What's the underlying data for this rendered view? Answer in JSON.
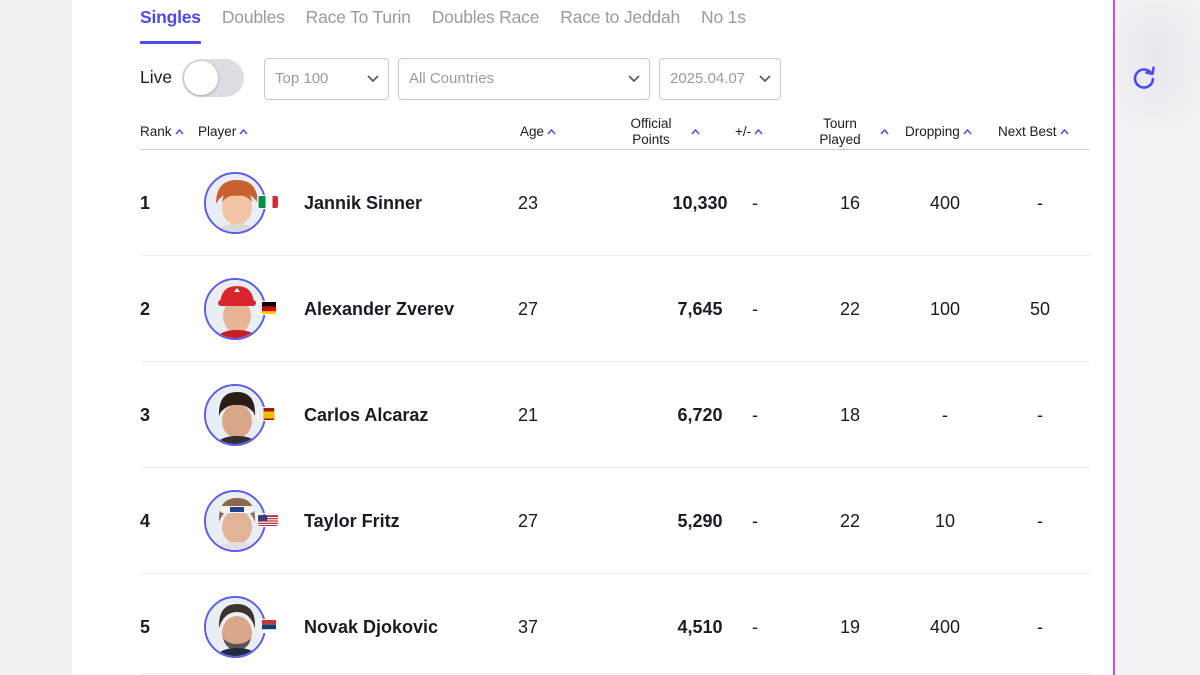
{
  "tabs": [
    {
      "label": "Singles",
      "active": true
    },
    {
      "label": "Doubles",
      "active": false
    },
    {
      "label": "Race To Turin",
      "active": false
    },
    {
      "label": "Doubles Race",
      "active": false
    },
    {
      "label": "Race to Jeddah",
      "active": false
    },
    {
      "label": "No 1s",
      "active": false
    }
  ],
  "filters": {
    "live_label": "Live",
    "live_on": false,
    "range": "Top 100",
    "country": "All Countries",
    "date": "2025.04.07",
    "refresh_icon": "refresh-icon"
  },
  "columns": {
    "rank": "Rank",
    "player": "Player",
    "age": "Age",
    "points_l1": "Official",
    "points_l2": "Points",
    "change": "+/-",
    "played_l1": "Tourn",
    "played_l2": "Played",
    "dropping": "Dropping",
    "next_best": "Next Best"
  },
  "colors": {
    "accent": "#4b4bf0",
    "text": "#1b1b25",
    "muted": "#9a9aa3"
  },
  "players": [
    {
      "rank": "1",
      "name": "Jannik Sinner",
      "age": "23",
      "points": "10,330",
      "change": "-",
      "played": "16",
      "dropping": "400",
      "next_best": "-",
      "flag": "flag-italy"
    },
    {
      "rank": "2",
      "name": "Alexander Zverev",
      "age": "27",
      "points": "7,645",
      "change": "-",
      "played": "22",
      "dropping": "100",
      "next_best": "50",
      "flag": "flag-germany"
    },
    {
      "rank": "3",
      "name": "Carlos Alcaraz",
      "age": "21",
      "points": "6,720",
      "change": "-",
      "played": "18",
      "dropping": "-",
      "next_best": "-",
      "flag": "flag-spain"
    },
    {
      "rank": "4",
      "name": "Taylor Fritz",
      "age": "27",
      "points": "5,290",
      "change": "-",
      "played": "22",
      "dropping": "10",
      "next_best": "-",
      "flag": "flag-usa"
    },
    {
      "rank": "5",
      "name": "Novak Djokovic",
      "age": "37",
      "points": "4,510",
      "change": "-",
      "played": "19",
      "dropping": "400",
      "next_best": "-",
      "flag": "flag-serbia"
    }
  ]
}
